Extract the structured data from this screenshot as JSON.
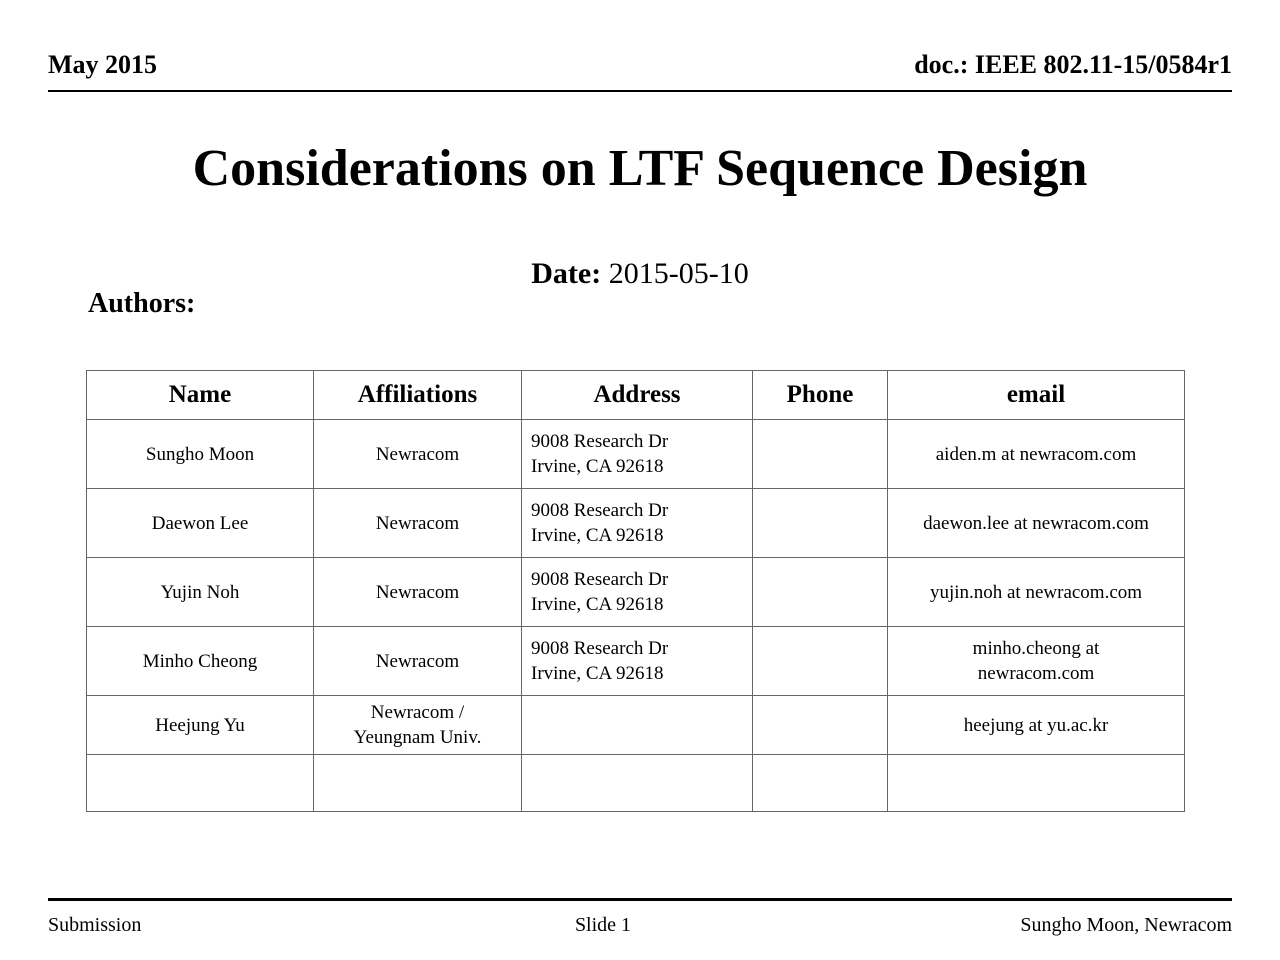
{
  "header": {
    "date_left": "May 2015",
    "doc_right": "doc.: IEEE 802.11-15/0584r1"
  },
  "title": "Considerations on LTF Sequence Design",
  "date_line": {
    "label": "Date:",
    "value": " 2015-05-10"
  },
  "authors_heading": "Authors:",
  "table": {
    "columns": [
      "Name",
      "Affiliations",
      "Address",
      "Phone",
      "email"
    ],
    "rows": [
      {
        "name": "Sungho Moon",
        "affiliation": "Newracom",
        "address_line1": "9008 Research Dr",
        "address_line2": "Irvine, CA 92618",
        "phone": "",
        "email_line1": "aiden.m at newracom.com",
        "email_line2": ""
      },
      {
        "name": "Daewon Lee",
        "affiliation": "Newracom",
        "address_line1": "9008 Research Dr",
        "address_line2": "Irvine, CA 92618",
        "phone": "",
        "email_line1": "daewon.lee at newracom.com",
        "email_line2": ""
      },
      {
        "name": "Yujin Noh",
        "affiliation": "Newracom",
        "address_line1": "9008 Research Dr",
        "address_line2": "Irvine, CA 92618",
        "phone": "",
        "email_line1": "yujin.noh at newracom.com",
        "email_line2": ""
      },
      {
        "name": "Minho Cheong",
        "affiliation": "Newracom",
        "address_line1": "9008 Research Dr",
        "address_line2": "Irvine, CA 92618",
        "phone": "",
        "email_line1": "minho.cheong at",
        "email_line2": "newracom.com"
      },
      {
        "name": "Heejung Yu",
        "affiliation_line1": "Newracom /",
        "affiliation_line2": "Yeungnam Univ.",
        "address_line1": "",
        "address_line2": "",
        "phone": "",
        "email_line1": "heejung at yu.ac.kr",
        "email_line2": ""
      },
      {
        "name": "",
        "affiliation": "",
        "address_line1": "",
        "address_line2": "",
        "phone": "",
        "email_line1": "",
        "email_line2": ""
      }
    ]
  },
  "footer": {
    "left": "Submission",
    "center": "Slide 1",
    "right": "Sungho Moon, Newracom"
  }
}
